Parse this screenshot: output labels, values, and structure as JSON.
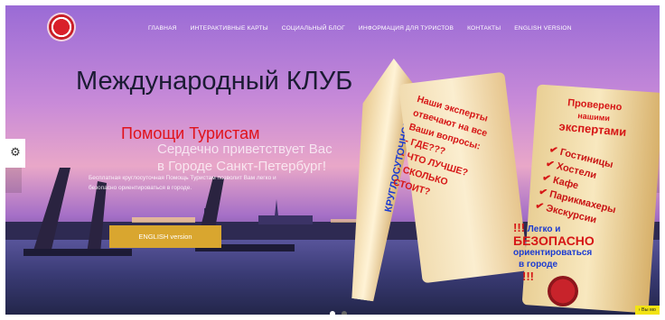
{
  "nav": {
    "items": [
      "ГЛАВНАЯ",
      "ИНТЕРАКТИВНЫЕ КАРТЫ",
      "СОЦИАЛЬНЫЙ БЛОГ",
      "ИНФОРМАЦИЯ ДЛЯ ТУРИСТОВ",
      "КОНТАКТЫ",
      "ENGLISH VERSION"
    ]
  },
  "hero": {
    "title": "Международный КЛУБ",
    "subtitle": "Помощи Туристам",
    "greeting_line1": "Сердечно приветствует Вас",
    "greeting_line2": "в Городе Санкт-Петербург!",
    "description": "Бесплатная круглосуточная Помощь Туристам позволит Вам легко и безопасно ориентироваться в городе.",
    "button_label": "ENGLISH version"
  },
  "scroll_left": {
    "side": "КРУГЛОСУТОЧНО!!!",
    "lines": [
      "Наши эксперты",
      "отвечают на все",
      "Ваши вопросы:",
      "- ГДЕ???",
      "- ЧТО ЛУЧШЕ?",
      "- СКОЛЬКО",
      "СТОИТ?"
    ]
  },
  "scroll_right": {
    "lines": [
      "Проверено",
      "нашими",
      "экспертами"
    ],
    "checks": [
      "Гостиницы",
      "Хостели",
      "Кафе",
      "Парикмахеры",
      "Экскурсии"
    ],
    "exclaim": "!!!",
    "easy": "Легко и",
    "safe": "БЕЗОПАСНО",
    "orient": "ориентироваться",
    "city": "в городе",
    "exclaim2": "!!!"
  },
  "badge_text": "Вы мо",
  "colors": {
    "accent_red": "#e0121b",
    "button": "#d9a62f"
  }
}
